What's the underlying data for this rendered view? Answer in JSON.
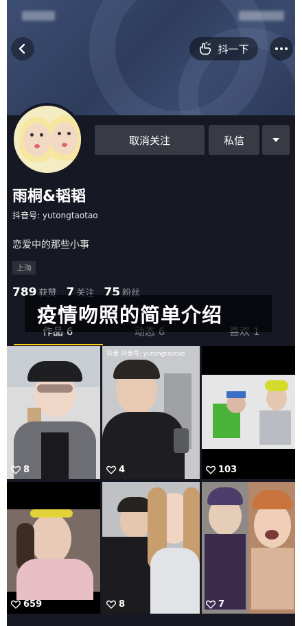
{
  "nav": {
    "shake_label": "抖一下"
  },
  "profile": {
    "name": "雨桐&韬韬",
    "douyin_id": "抖音号: yutongtaotao",
    "bio": "恋爱中的那些小事",
    "location": "上海",
    "unfollow_label": "取消关注",
    "message_label": "私信"
  },
  "stats": [
    {
      "num": "789",
      "label": "获赞"
    },
    {
      "num": "7",
      "label": "关注"
    },
    {
      "num": "75",
      "label": "粉丝"
    }
  ],
  "caption": "疫情吻照的简单介绍",
  "tabs": [
    {
      "label": "作品 6"
    },
    {
      "label": "动态 6"
    },
    {
      "label": "喜欢 1"
    }
  ],
  "videos": [
    {
      "likes": "8"
    },
    {
      "likes": "4",
      "watermark": "抖音 抖音号: yutongtaotao"
    },
    {
      "likes": "103"
    },
    {
      "likes": "659"
    },
    {
      "likes": "8"
    },
    {
      "likes": "7"
    }
  ],
  "colors": {
    "background": "#161823",
    "accent": "#face15",
    "button": "#393b44"
  }
}
